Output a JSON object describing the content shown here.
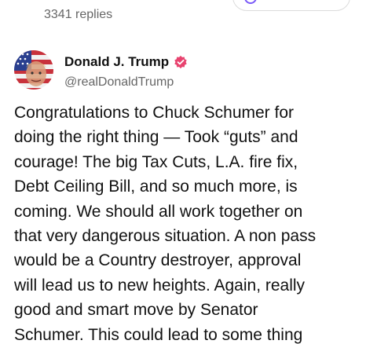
{
  "previous_post": {
    "replies": "3341 replies"
  },
  "post": {
    "author": {
      "display_name": "Donald J. Trump",
      "handle": "@realDonaldTrump",
      "verified_color": "#e8436f"
    },
    "text": "Congratulations to Chuck Schumer for\ndoing the right thing — Took “guts” and\ncourage! The big Tax Cuts, L.A. fire fix,\nDebt Ceiling Bill, and so much more, is\ncoming. We should all work together on\nthat very dangerous situation. A non pass\nwould be a Country destroyer, approval\nwill lead us to new heights. Again, really\ngood and smart move by Senator\nSchumer. This could lead to some thing"
  },
  "colors": {
    "text_primary": "#111111",
    "text_secondary": "#666666",
    "accent_purple": "#7a5af8"
  },
  "icons": {
    "avatar": "flag-portrait-avatar",
    "verified": "verified-badge-icon",
    "pill": "circle-dot-icon"
  }
}
